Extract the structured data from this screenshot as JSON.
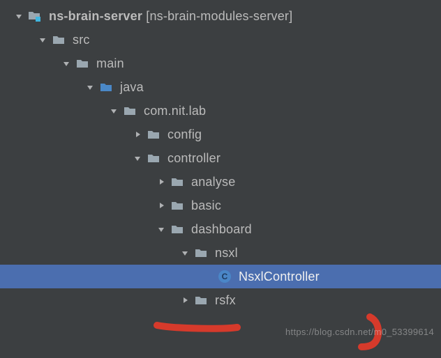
{
  "tree": {
    "module_name": "ns-brain-server",
    "module_bracket": "[ns-brain-modules-server]",
    "src": "src",
    "main": "main",
    "java": "java",
    "pkg": "com.nit.lab",
    "config": "config",
    "controller": "controller",
    "analyse": "analyse",
    "basic": "basic",
    "dashboard": "dashboard",
    "nsxl": "nsxl",
    "nsxl_controller": "NsxlController",
    "rsfx": "rsfx"
  },
  "watermark": "https://blog.csdn.net/m0_53399614"
}
